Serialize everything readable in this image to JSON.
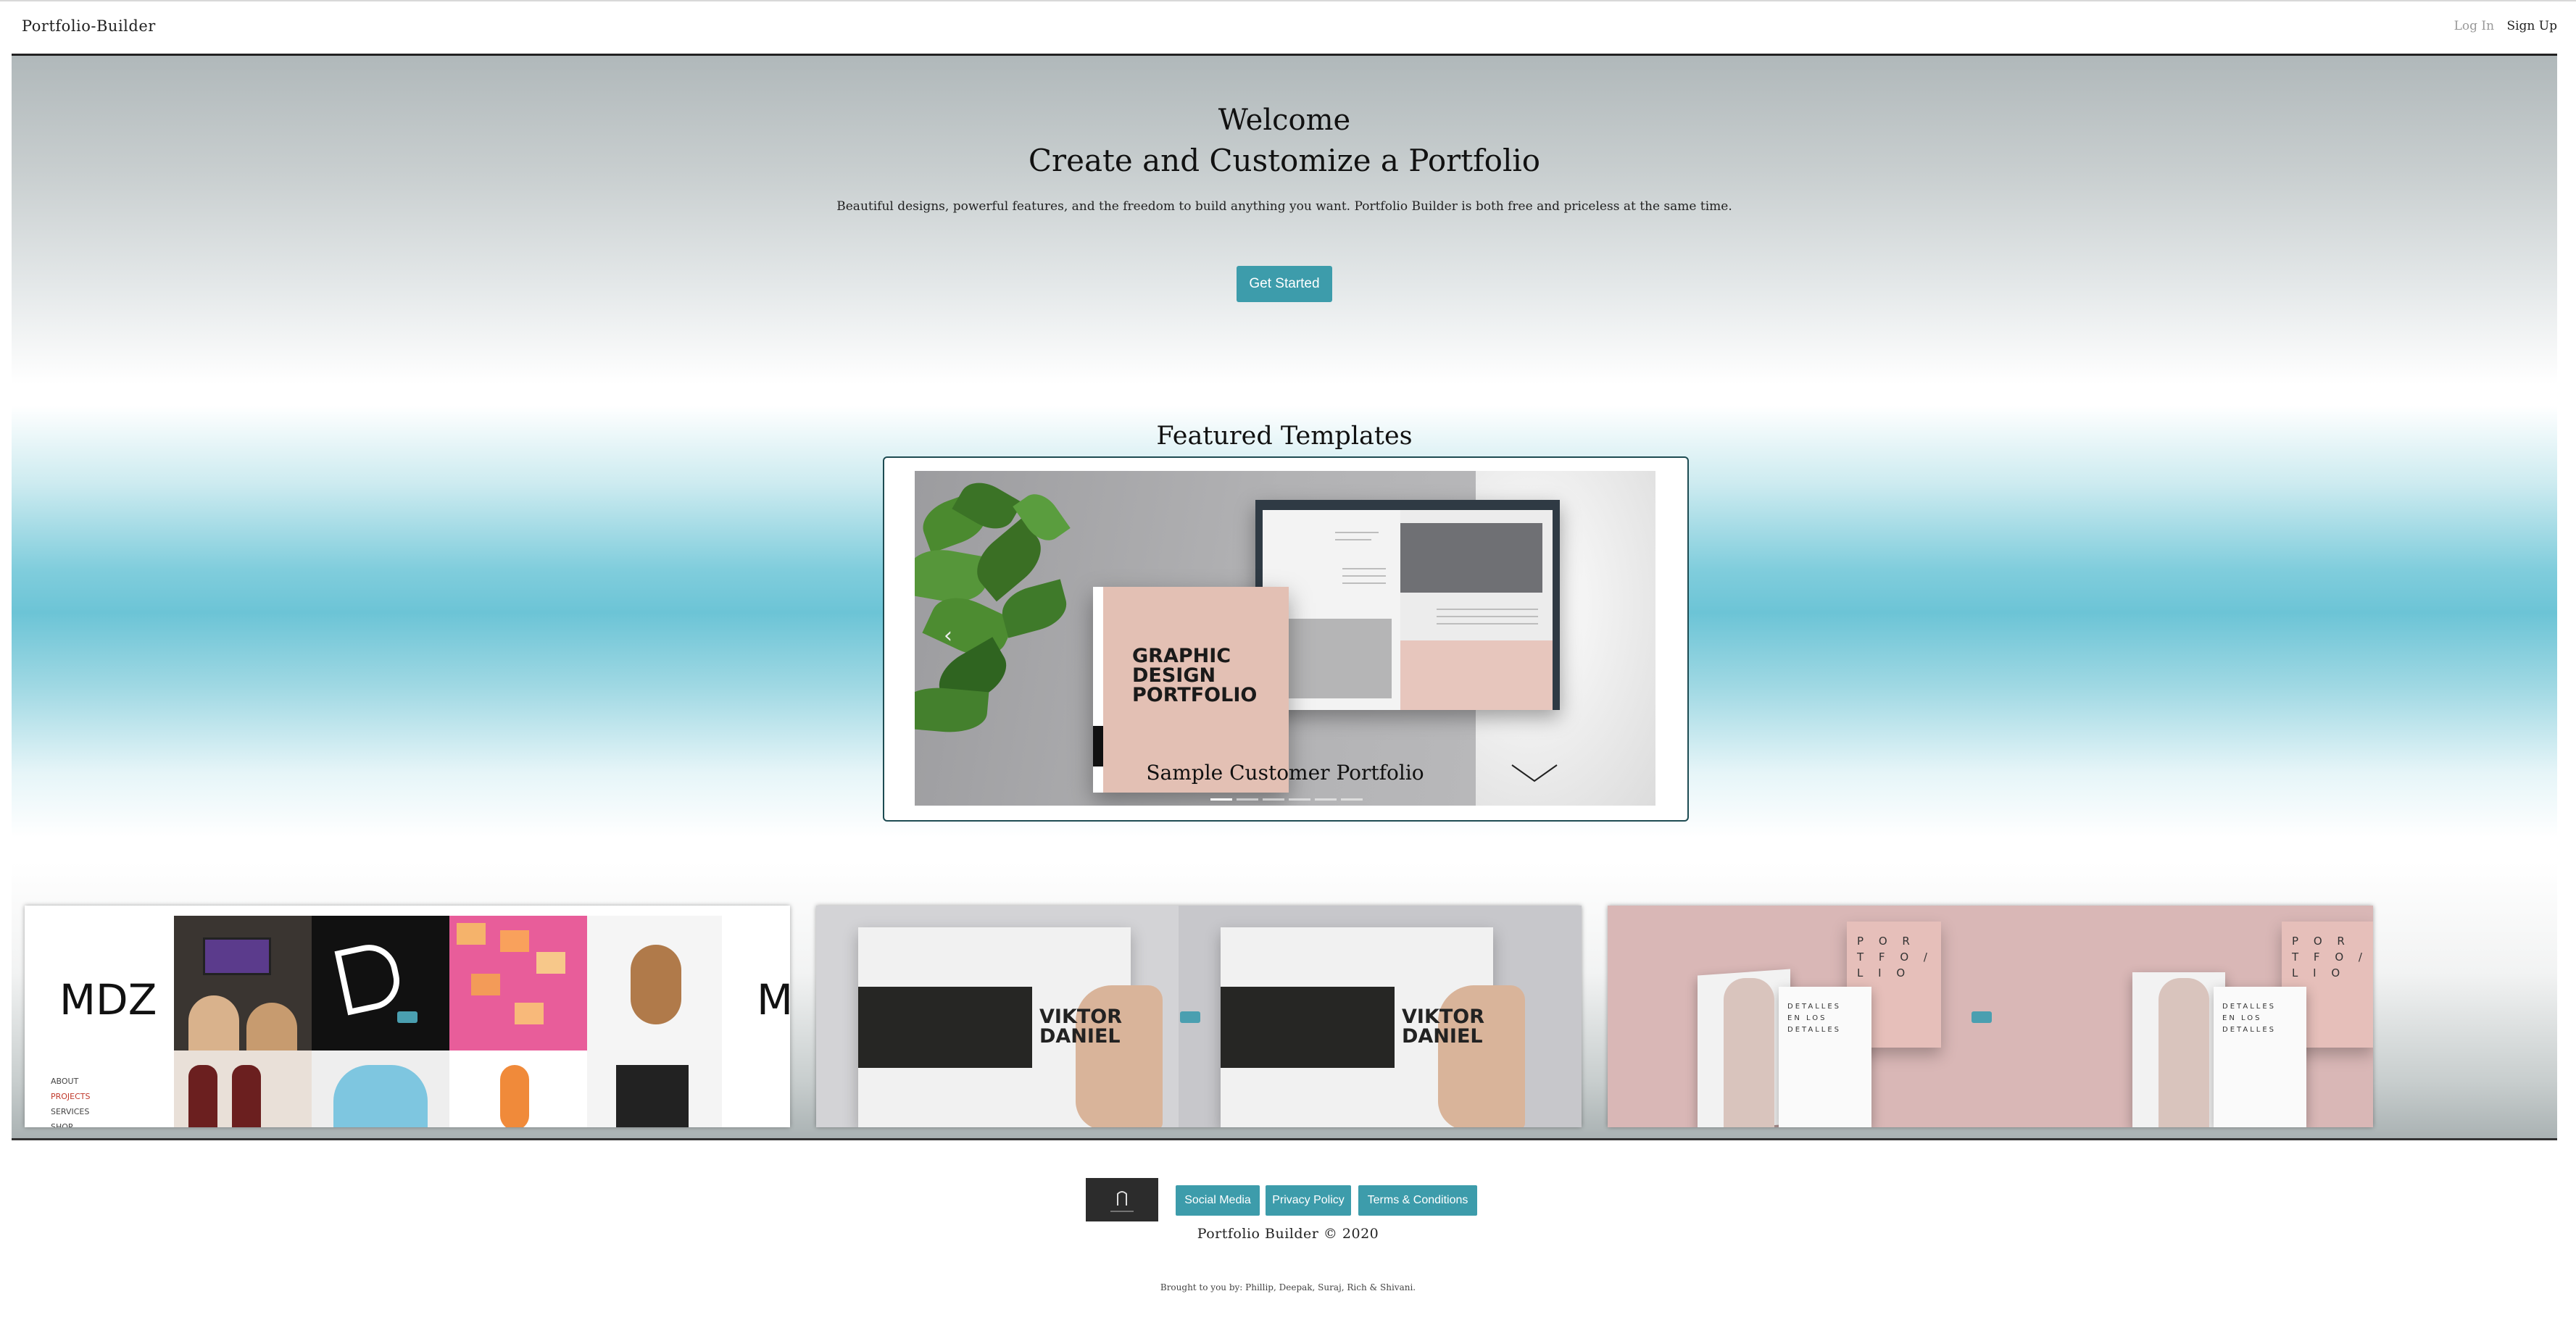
{
  "navbar": {
    "brand": "Portfolio-Builder",
    "login": "Log In",
    "signup": "Sign Up"
  },
  "hero": {
    "welcome": "Welcome",
    "title": "Create and Customize a Portfolio",
    "description": "Beautiful designs, powerful features, and the freedom to build anything you want. Portfolio Builder is both free and priceless at the same time.",
    "cta_label": "Get Started"
  },
  "featured": {
    "title": "Featured Templates",
    "slide_caption": "Sample Customer Portfolio",
    "slide_cover_text": "GRAPHIC DESIGN PORTFOLIO",
    "indicator_count": 6,
    "active_indicator": 1
  },
  "thumbnails": {
    "mdz": {
      "logo": "MDZ",
      "menu": [
        "ABOUT",
        "PROJECTS",
        "SERVICES",
        "SHOP"
      ]
    },
    "viktor": {
      "title_line1": "VIKTOR",
      "title_line2": "DANIEL"
    },
    "portfolio": {
      "card_text": "P O R T F O / L I O",
      "book_text": "DETALLES EN LOS DETALLES"
    }
  },
  "footer": {
    "buttons": [
      "Social Media",
      "Privacy Policy",
      "Terms & Conditions"
    ],
    "copyright": "Portfolio Builder © 2020",
    "credits": "Brought to you by: Phillip, Deepak, Suraj, Rich & Shivani."
  },
  "colors": {
    "accent": "#3d9cab",
    "hero_top": "#b0b8ba",
    "band_mid": "#6cc4d6",
    "frame_border": "#1d4b52"
  }
}
